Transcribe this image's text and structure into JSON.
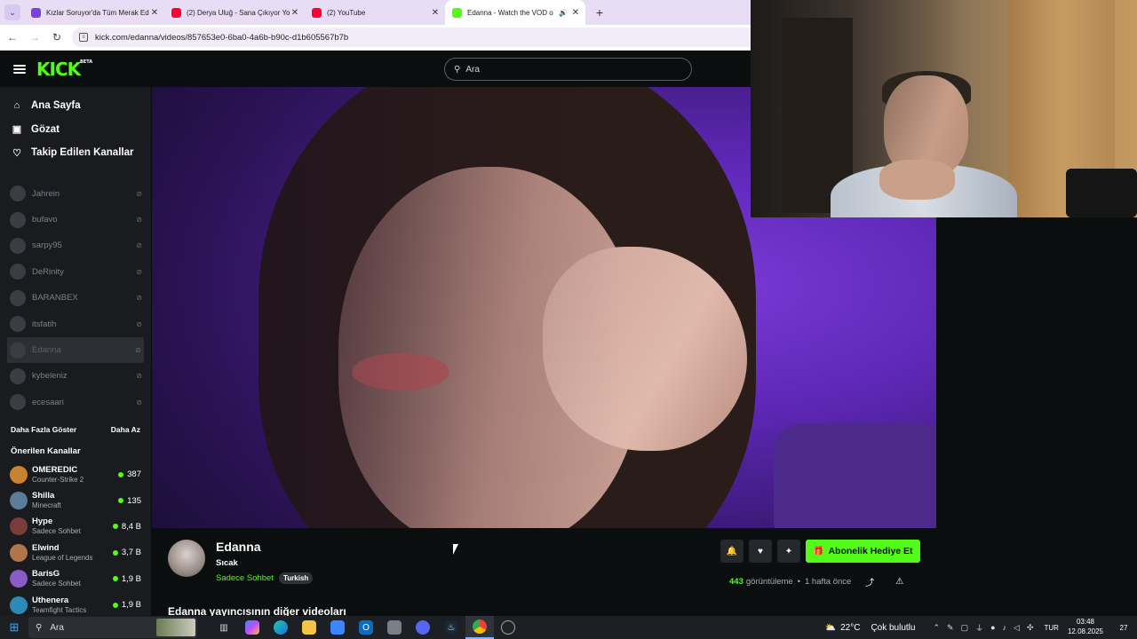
{
  "browser": {
    "tabs": [
      {
        "title": "Kızlar Soruyor'da Tüm Merak Ed",
        "favicon_color": "#7b3fe4"
      },
      {
        "title": "(2) Derya Uluğ - Sana Çıkıyor Yo",
        "favicon_color": "#ff0033"
      },
      {
        "title": "(2) YouTube",
        "favicon_color": "#ff0033"
      },
      {
        "title": "Edanna - Watch the VOD o",
        "favicon_color": "#53fc18"
      }
    ],
    "url": "kick.com/edanna/videos/857653e0-6ba0-4a6b-b90c-d1b605567b7b"
  },
  "header": {
    "logo": "KICK",
    "logo_badge": "BETA",
    "search_placeholder": "Ara"
  },
  "sidebar": {
    "nav": [
      {
        "label": "Ana Sayfa",
        "icon": "home-icon"
      },
      {
        "label": "Gözat",
        "icon": "browse-icon"
      },
      {
        "label": "Takip Edilen Kanallar",
        "icon": "heart-icon"
      }
    ],
    "followed": [
      "Jahrein",
      "bufavo",
      "sarpy95",
      "DeRinity",
      "BARANBEX",
      "itsfatih",
      "Edanna",
      "kybeleniz",
      "ecesaari"
    ],
    "show_more": "Daha Fazla Göster",
    "show_less": "Daha Az",
    "recommended_title": "Önerilen Kanallar",
    "recommended": [
      {
        "name": "OMEREDIC",
        "category": "Counter-Strike 2",
        "viewers": "387",
        "avatar_color": "#c9822f"
      },
      {
        "name": "Shilla",
        "category": "Minecraft",
        "viewers": "135",
        "avatar_color": "#5a7d99"
      },
      {
        "name": "Hype",
        "category": "Sadece Sohbet",
        "viewers": "8,4 B",
        "avatar_color": "#7a3b3b"
      },
      {
        "name": "Elwind",
        "category": "League of Legends",
        "viewers": "3,7 B",
        "avatar_color": "#b0764a"
      },
      {
        "name": "BarisG",
        "category": "Sadece Sohbet",
        "viewers": "1,9 B",
        "avatar_color": "#8a5cc8"
      },
      {
        "name": "Uthenera",
        "category": "Teamfight Tactics",
        "viewers": "1,9 B",
        "avatar_color": "#2c8ab8"
      }
    ]
  },
  "channel": {
    "name": "Edanna",
    "title": "Sıcak",
    "category": "Sadece Sohbet",
    "language": "Turkish",
    "views_count": "443",
    "views_label": "görüntüleme",
    "age": "1 hafta önce",
    "gift_label": "Abonelik Hediye Et",
    "other_videos": "Edanna yayıncısının diğer videoları"
  },
  "taskbar": {
    "search": "Ara",
    "weather_temp": "22°C",
    "weather_desc": "Çok bulutlu",
    "lang": "TUR",
    "time": "03:48",
    "date": "12.08.2025",
    "notifications": "27"
  },
  "colors": {
    "accent": "#53fc18",
    "background": "#0b0e0f",
    "sidebar": "#191b1f"
  }
}
